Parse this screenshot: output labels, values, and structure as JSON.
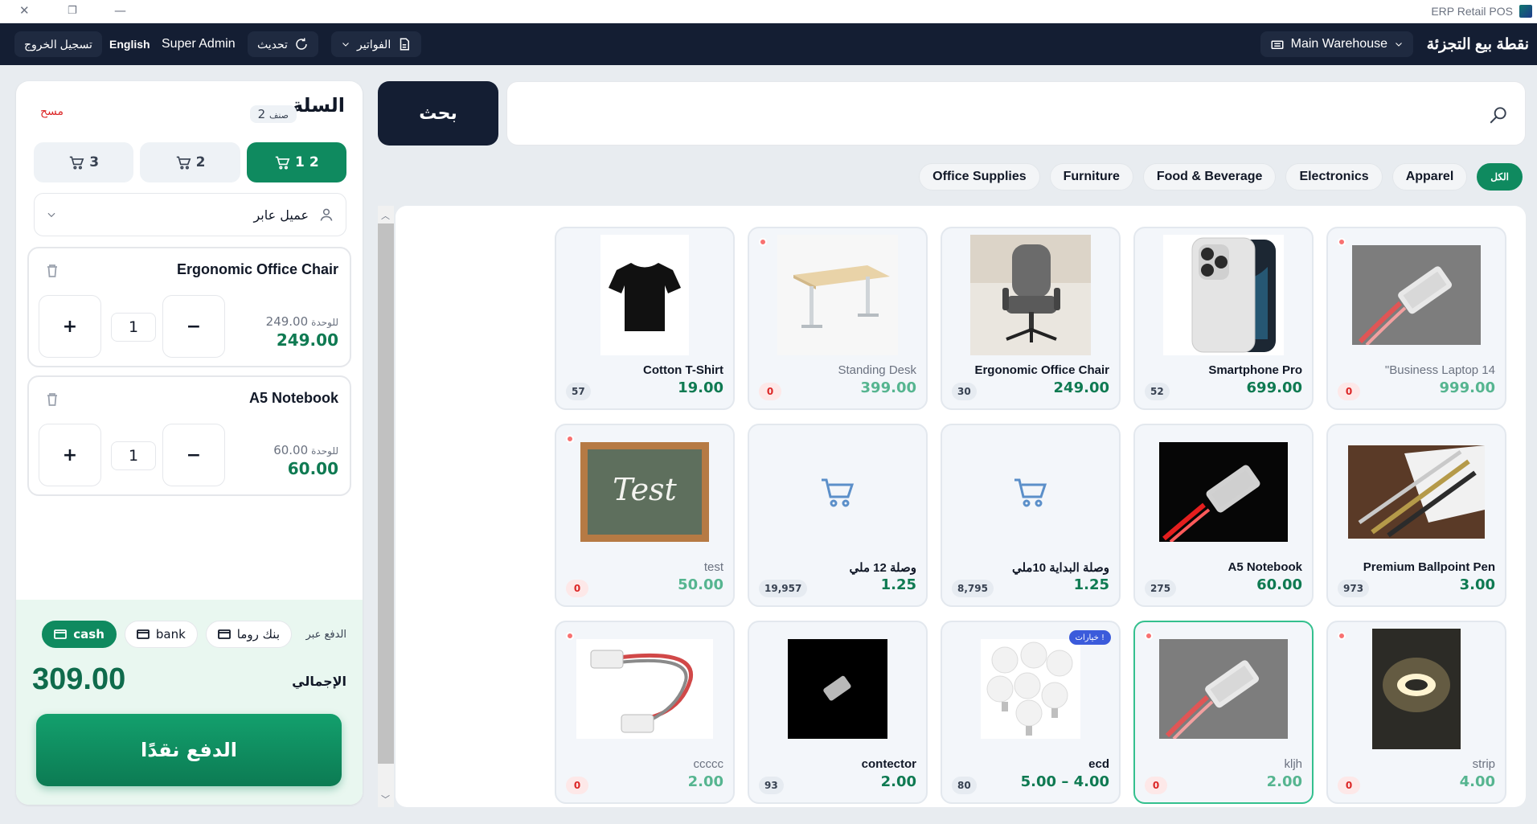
{
  "window": {
    "title": "ERP Retail POS"
  },
  "topnav": {
    "brand": "نقطة بيع التجزئة",
    "warehouse": "Main Warehouse",
    "invoices": "الفواتير",
    "refresh": "تحديث",
    "user": "Super Admin",
    "language": "English",
    "logout": "تسجيل الخروج"
  },
  "cart": {
    "title": "السلة",
    "count": "2",
    "count_label": "صنف",
    "clear": "مسح",
    "tabs": [
      {
        "label": "1",
        "badge": "2",
        "active": true
      },
      {
        "label": "2"
      },
      {
        "label": "3"
      }
    ],
    "customer": "عميل عابر",
    "items": [
      {
        "name": "Ergonomic Office Chair",
        "unit_price": "249.00",
        "unit_label": "للوحدة",
        "total": "249.00",
        "qty": "1"
      },
      {
        "name": "A5 Notebook",
        "unit_price": "60.00",
        "unit_label": "للوحدة",
        "total": "60.00",
        "qty": "1"
      }
    ],
    "plus": "+",
    "minus": "−",
    "pay_via": "الدفع عبر",
    "methods": [
      {
        "label": "cash",
        "active": true
      },
      {
        "label": "bank"
      },
      {
        "label": "بنك روما"
      }
    ],
    "total_label": "الإجمالي",
    "total": "309.00",
    "pay_button": "الدفع نقدًا"
  },
  "search": {
    "button": "بحث",
    "placeholder": ""
  },
  "categories": [
    "الكل",
    "Apparel",
    "Electronics",
    "Food & Beverage",
    "Furniture",
    "Office Supplies"
  ],
  "products": [
    {
      "name": "Cotton T-Shirt",
      "price": "19.00",
      "stock": "57",
      "img": "tshirt-image"
    },
    {
      "name": "Standing Desk",
      "price": "399.00",
      "stock": "0",
      "img": "desk-image",
      "out": true
    },
    {
      "name": "Ergonomic Office Chair",
      "price": "249.00",
      "stock": "30",
      "img": "chair-image"
    },
    {
      "name": "Smartphone Pro",
      "price": "699.00",
      "stock": "52",
      "img": "phone-image"
    },
    {
      "name": "\"Business Laptop 14",
      "price": "999.00",
      "stock": "0",
      "img": "connector-gray-image",
      "out": true
    },
    {
      "name": "test",
      "price": "50.00",
      "stock": "0",
      "img": "chalkboard-image",
      "out": true
    },
    {
      "name": "وصلة 12 ملي",
      "price": "1.25",
      "stock": "19,957",
      "img": "placeholder-cart-icon"
    },
    {
      "name": "وصلة البداية 10ملي",
      "price": "1.25",
      "stock": "8,795",
      "img": "placeholder-cart-icon"
    },
    {
      "name": "A5 Notebook",
      "price": "60.00",
      "stock": "275",
      "img": "connector-black-image"
    },
    {
      "name": "Premium Ballpoint Pen",
      "price": "3.00",
      "stock": "973",
      "img": "pens-image"
    },
    {
      "name": "ccccc",
      "price": "2.00",
      "stock": "0",
      "img": "cable-image",
      "out": true
    },
    {
      "name": "contector",
      "price": "2.00",
      "stock": "93",
      "img": "connector-small-image"
    },
    {
      "name": "ecd",
      "price": "5.00 – 4.00",
      "stock": "80",
      "img": "bulbs-image",
      "badge": "خيارات !"
    },
    {
      "name": "kljh",
      "price": "2.00",
      "stock": "0",
      "img": "connector-gray-image",
      "out": true,
      "selected": true
    },
    {
      "name": "strip",
      "price": "4.00",
      "stock": "0",
      "img": "led-strip-image",
      "out": true
    }
  ],
  "colors": {
    "accent": "#0f8a5f",
    "nav": "#141e33",
    "price": "#0f7a52",
    "danger": "#dc2626"
  }
}
